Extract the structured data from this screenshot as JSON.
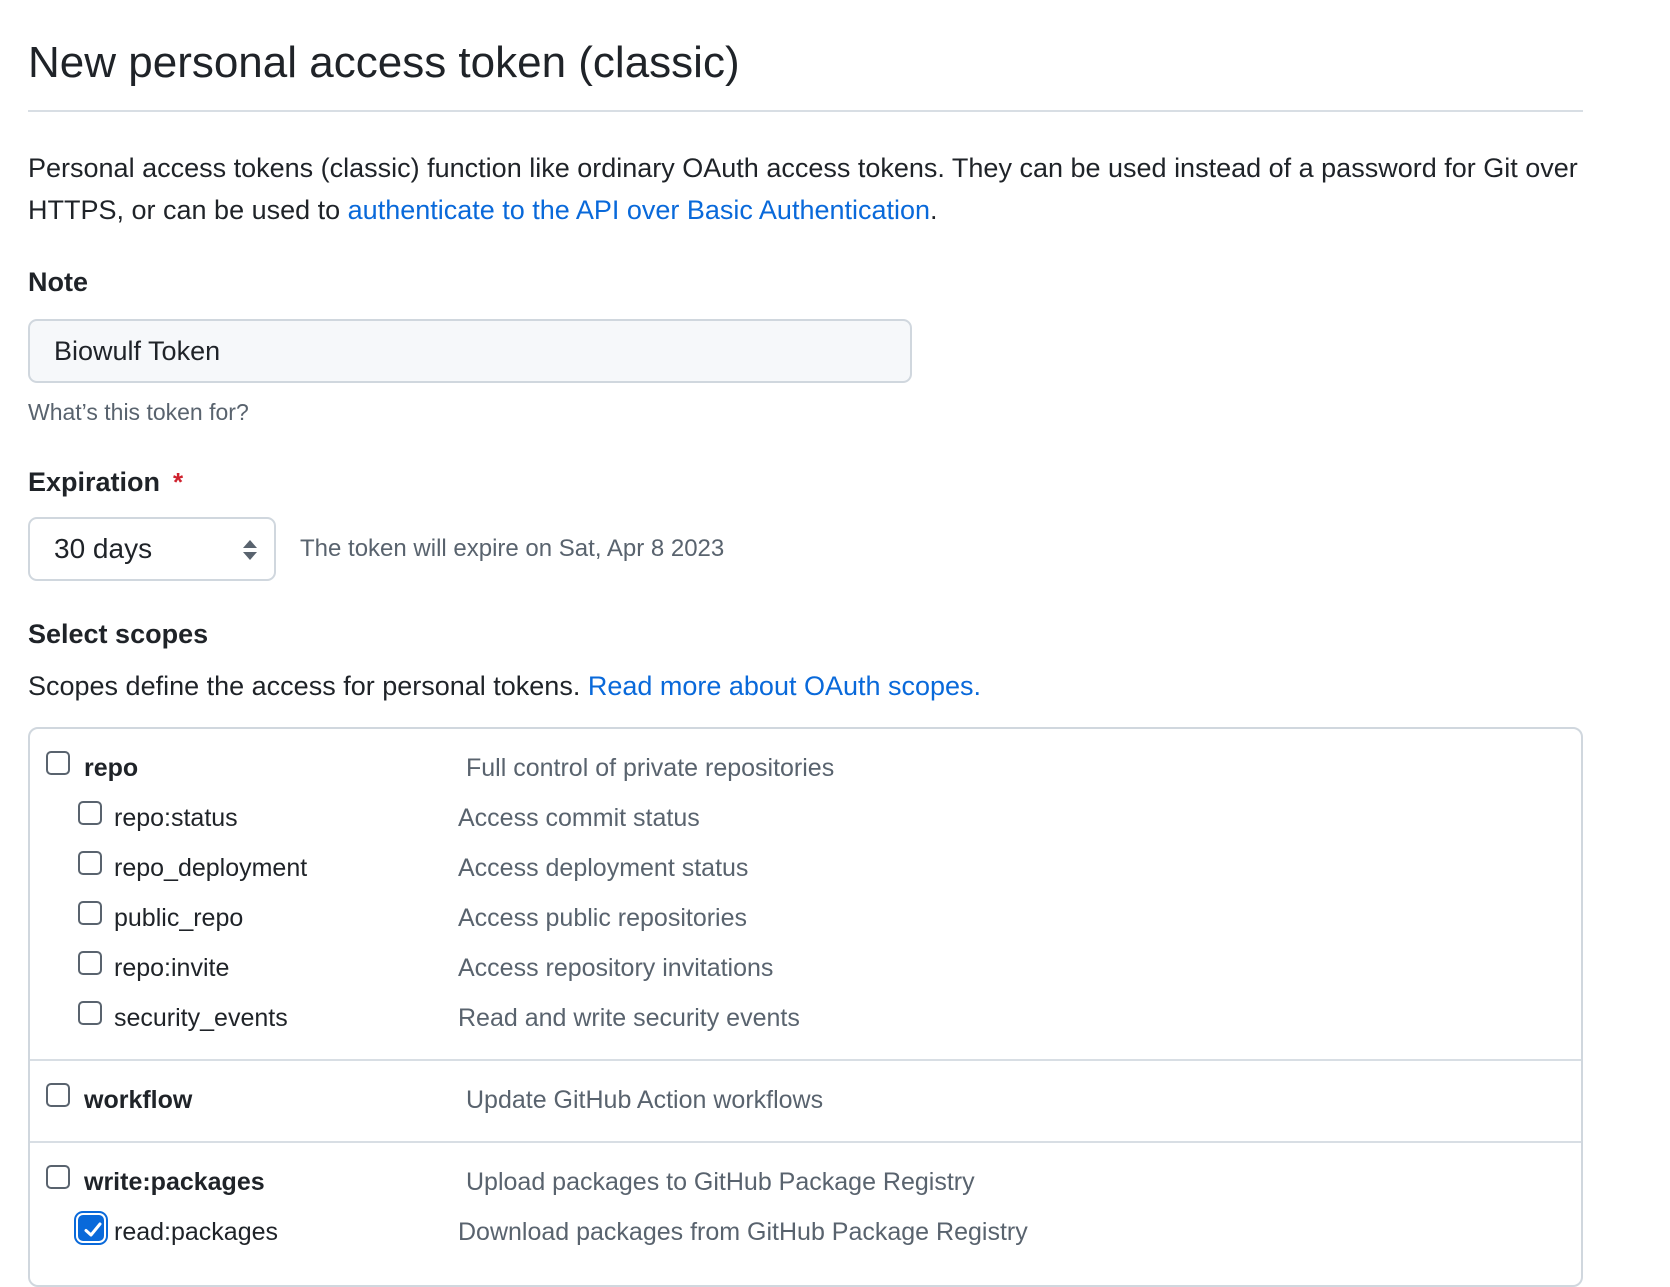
{
  "page": {
    "title": "New personal access token (classic)",
    "intro_text": "Personal access tokens (classic) function like ordinary OAuth access tokens. They can be used instead of a password for Git over HTTPS, or can be used to ",
    "intro_link": "authenticate to the API over Basic Authentication",
    "intro_end": "."
  },
  "note": {
    "label": "Note",
    "value": "Biowulf Token",
    "hint": "What’s this token for?"
  },
  "expiration": {
    "label": "Expiration",
    "required_mark": "*",
    "selected": "30 days",
    "expire_text": "The token will expire on Sat, Apr 8 2023"
  },
  "scopes": {
    "label": "Select scopes",
    "description": "Scopes define the access for personal tokens. ",
    "read_more_link": "Read more about OAuth scopes.",
    "groups": [
      {
        "name": "repo",
        "description": "Full control of private repositories",
        "checked": false,
        "children": [
          {
            "name": "repo:status",
            "description": "Access commit status",
            "checked": false
          },
          {
            "name": "repo_deployment",
            "description": "Access deployment status",
            "checked": false
          },
          {
            "name": "public_repo",
            "description": "Access public repositories",
            "checked": false
          },
          {
            "name": "repo:invite",
            "description": "Access repository invitations",
            "checked": false
          },
          {
            "name": "security_events",
            "description": "Read and write security events",
            "checked": false
          }
        ]
      },
      {
        "name": "workflow",
        "description": "Update GitHub Action workflows",
        "checked": false,
        "children": []
      },
      {
        "name": "write:packages",
        "description": "Upload packages to GitHub Package Registry",
        "checked": false,
        "children": [
          {
            "name": "read:packages",
            "description": "Download packages from GitHub Package Registry",
            "checked": true
          }
        ]
      }
    ]
  },
  "colors": {
    "link": "#0969da",
    "required": "#cf222e",
    "checkbox_checked": "#0969da",
    "muted_text": "#59636e"
  }
}
